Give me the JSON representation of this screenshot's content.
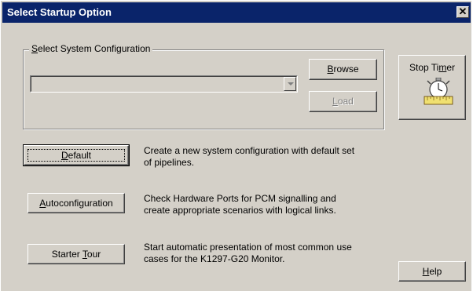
{
  "window": {
    "title": "Select Startup Option",
    "close_glyph": "✕"
  },
  "config_group": {
    "label_mnemonic": "S",
    "label_rest": "elect System Configuration",
    "combo_value": "",
    "browse_mnemonic": "B",
    "browse_rest": "rowse",
    "load_mnemonic": "L",
    "load_rest": "oad"
  },
  "stop_timer": {
    "label_pre": "Stop Ti",
    "label_mnemonic": "m",
    "label_post": "er",
    "icon": "stopwatch-icon"
  },
  "options": [
    {
      "btn_pre": "",
      "btn_mnemonic": "D",
      "btn_post": "efault",
      "line1": "Create a new system configuration with default set",
      "line2": "of pipelines."
    },
    {
      "btn_pre": "",
      "btn_mnemonic": "A",
      "btn_post": "utoconfiguration",
      "line1": "Check Hardware Ports for PCM signalling and",
      "line2": "create appropriate scenarios with logical links."
    },
    {
      "btn_pre": "Starter ",
      "btn_mnemonic": "T",
      "btn_post": "our",
      "line1": "Start automatic presentation of most common use",
      "line2": "cases for the K1297-G20 Monitor."
    }
  ],
  "help": {
    "mnemonic": "H",
    "rest": "elp"
  }
}
